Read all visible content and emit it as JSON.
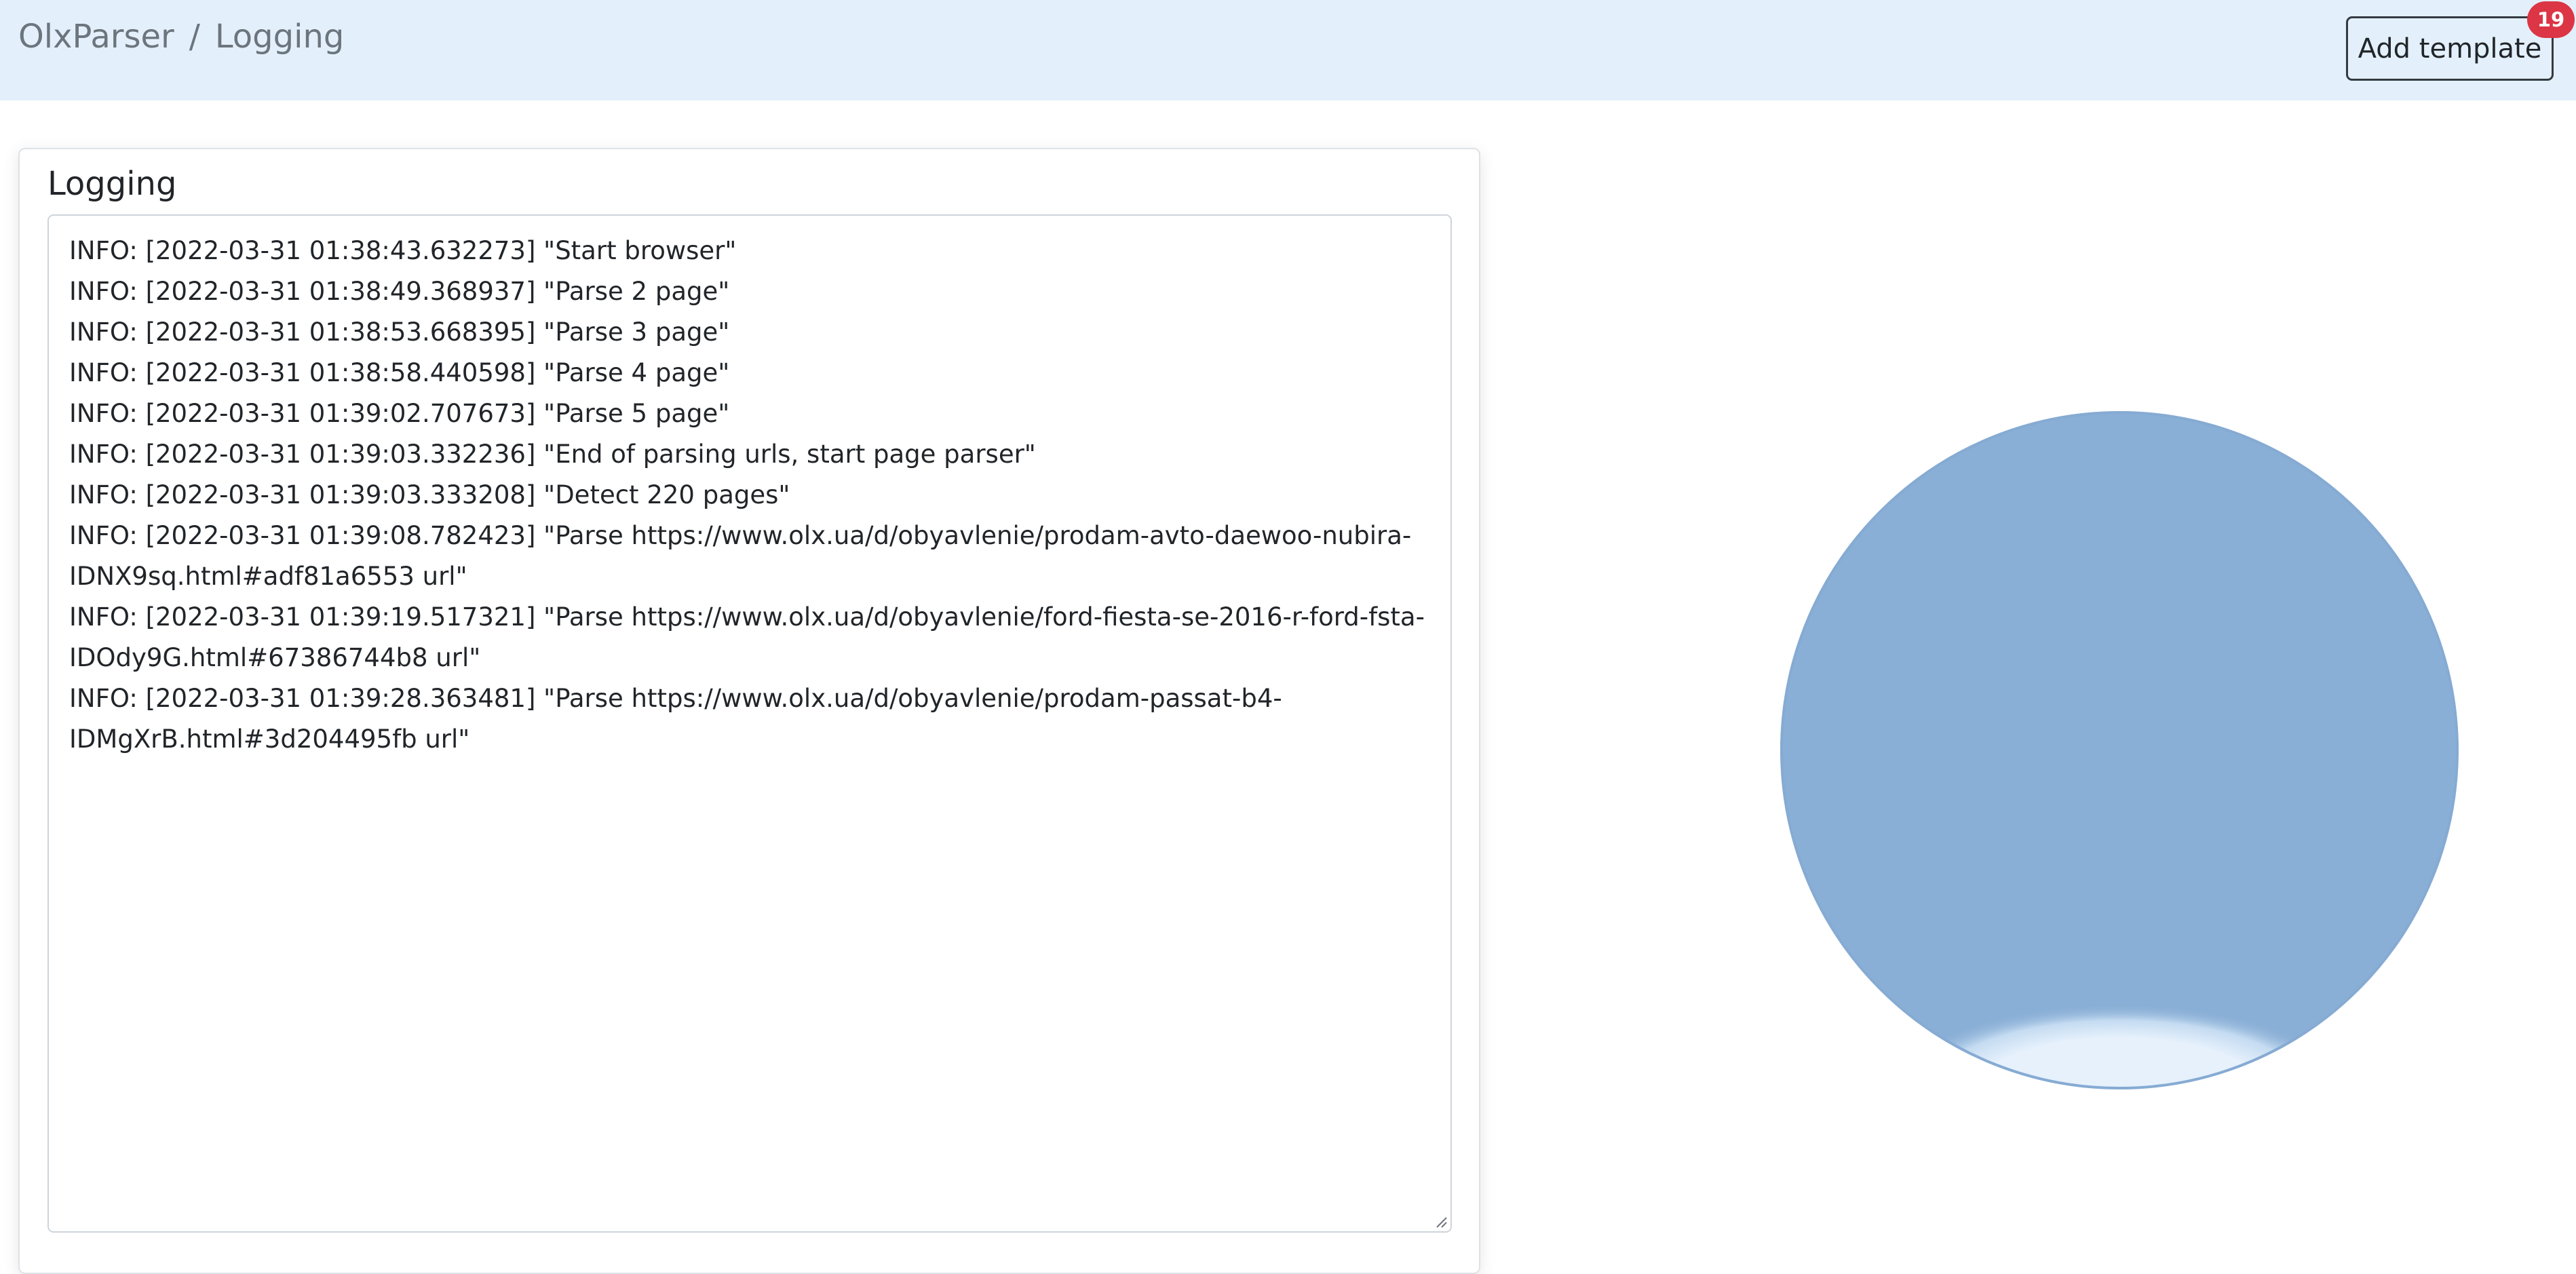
{
  "header": {
    "breadcrumb": {
      "root": "OlxParser",
      "separator": "/",
      "current": "Logging"
    },
    "add_template_label": "Add template",
    "badge_count": "19",
    "colors": {
      "background": "#e3f0fb",
      "badge": "#dc3545"
    }
  },
  "logging_card": {
    "title": "Logging",
    "lines": [
      "INFO: [2022-03-31 01:38:43.632273] \"Start browser\"",
      "INFO: [2022-03-31 01:38:49.368937] \"Parse 2 page\"",
      "INFO: [2022-03-31 01:38:53.668395] \"Parse 3 page\"",
      "INFO: [2022-03-31 01:38:58.440598] \"Parse 4 page\"",
      "INFO: [2022-03-31 01:39:02.707673] \"Parse 5 page\"",
      "INFO: [2022-03-31 01:39:03.332236] \"End of parsing urls, start page parser\"",
      "INFO: [2022-03-31 01:39:03.333208] \"Detect 220 pages\"",
      "INFO: [2022-03-31 01:39:08.782423] \"Parse https://www.olx.ua/d/obyavlenie/prodam-avto-daewoo-nubira-\nIDNX9sq.html#adf81a6553 url\"",
      "INFO: [2022-03-31 01:39:19.517321] \"Parse https://www.olx.ua/d/obyavlenie/ford-fiesta-se-2016-r-ford-fsta-\nIDOdy9G.html#67386744b8 url\"",
      "INFO: [2022-03-31 01:39:28.363481] \"Parse https://www.olx.ua/d/obyavlenie/prodam-passat-b4-\nIDMgXrB.html#3d204495fb url\""
    ]
  },
  "loader": {
    "colors": {
      "fill": "#8aafd6",
      "highlight": "#e6f1fc"
    }
  }
}
